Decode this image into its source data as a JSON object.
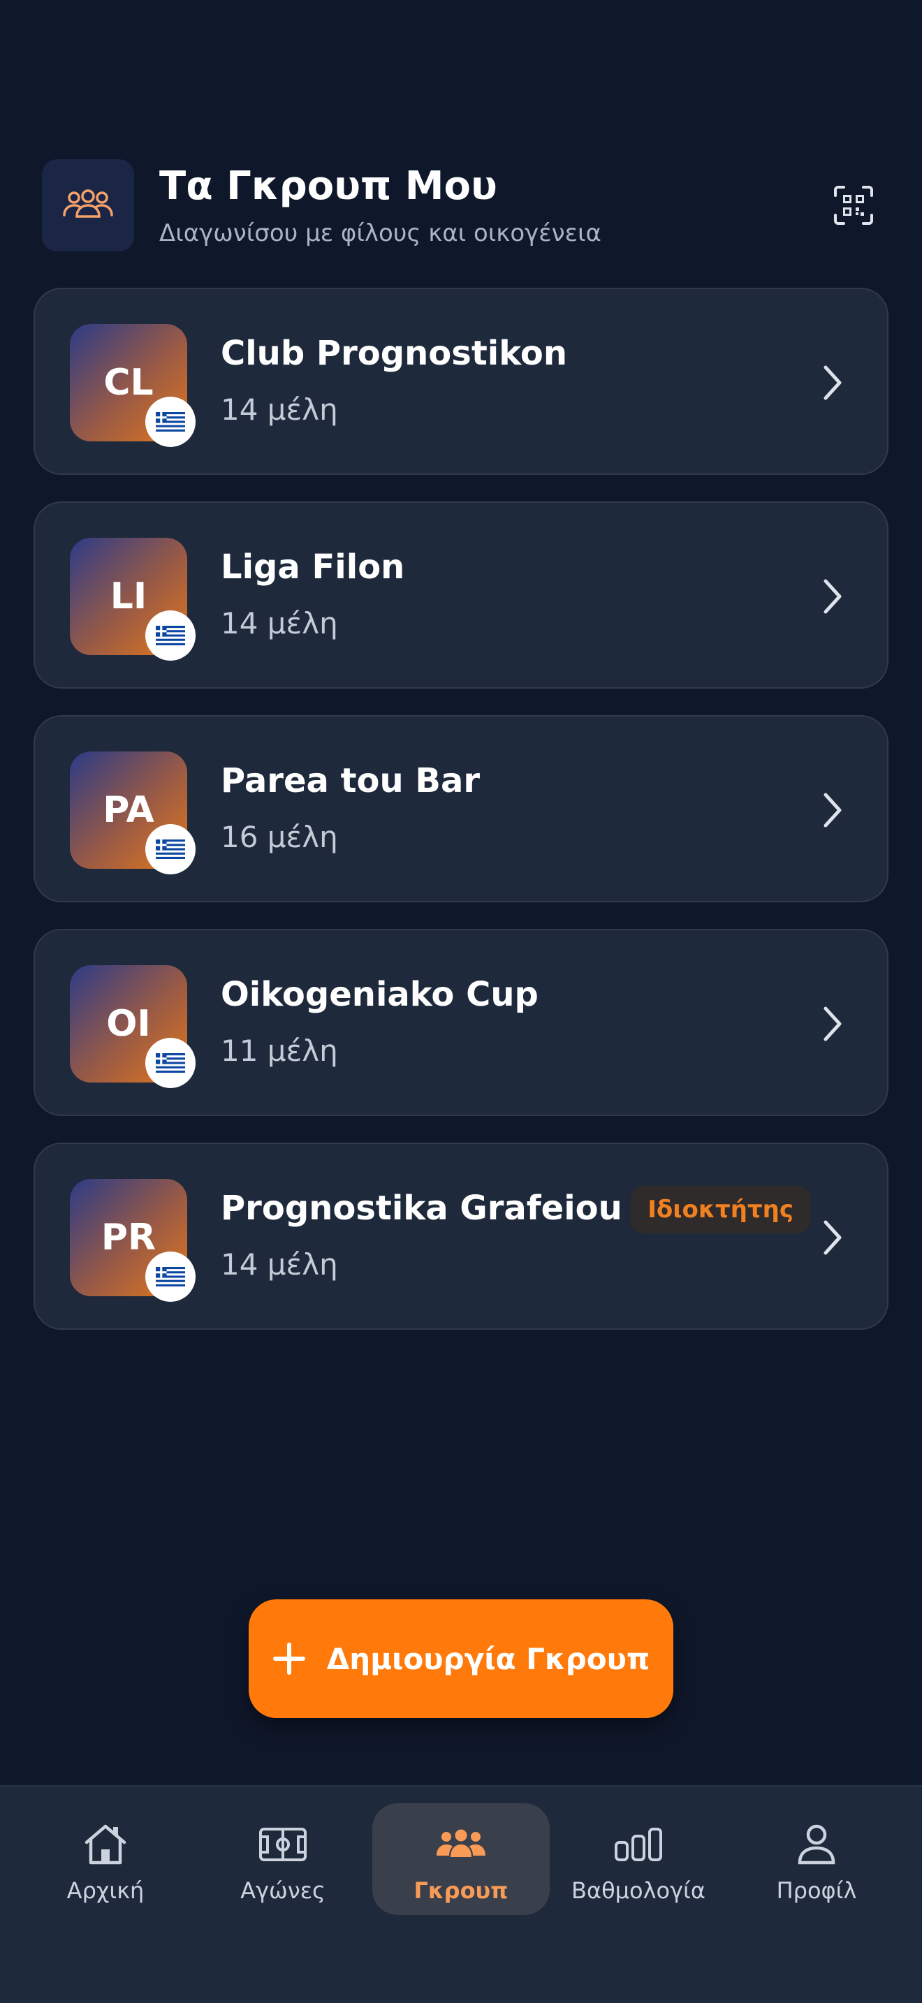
{
  "header": {
    "title": "Τα Γκρουπ Μου",
    "subtitle": "Διαγωνίσου με φίλους και οικογένεια",
    "icon": "groups-icon",
    "qr_icon": "qr-code-icon"
  },
  "groups": [
    {
      "initials": "CL",
      "name": "Club Prognostikon",
      "members": "14 μέλη",
      "badge": ""
    },
    {
      "initials": "LI",
      "name": "Liga Filon",
      "members": "14 μέλη",
      "badge": ""
    },
    {
      "initials": "PA",
      "name": "Parea tou Bar",
      "members": "16 μέλη",
      "badge": ""
    },
    {
      "initials": "OI",
      "name": "Oikogeniako Cup",
      "members": "11 μέλη",
      "badge": ""
    },
    {
      "initials": "PR",
      "name": "Prognostika Grafeiou",
      "members": "14 μέλη",
      "badge": "Ιδιοκτήτης"
    }
  ],
  "create_button": {
    "label": "Δημιουργία Γκρουπ",
    "icon": "plus-icon"
  },
  "nav": {
    "items": [
      {
        "label": "Αρχική",
        "icon": "home-icon"
      },
      {
        "label": "Αγώνες",
        "icon": "pitch-icon"
      },
      {
        "label": "Γκρουπ",
        "icon": "groups-icon"
      },
      {
        "label": "Βαθμολογία",
        "icon": "leaderboard-icon"
      },
      {
        "label": "Προφίλ",
        "icon": "profile-icon"
      }
    ],
    "active_index": 2
  },
  "colors": {
    "background": "#0f172a",
    "card": "#1e293b",
    "accent": "#ff7a0a",
    "active_nav_text": "#f79b57"
  }
}
